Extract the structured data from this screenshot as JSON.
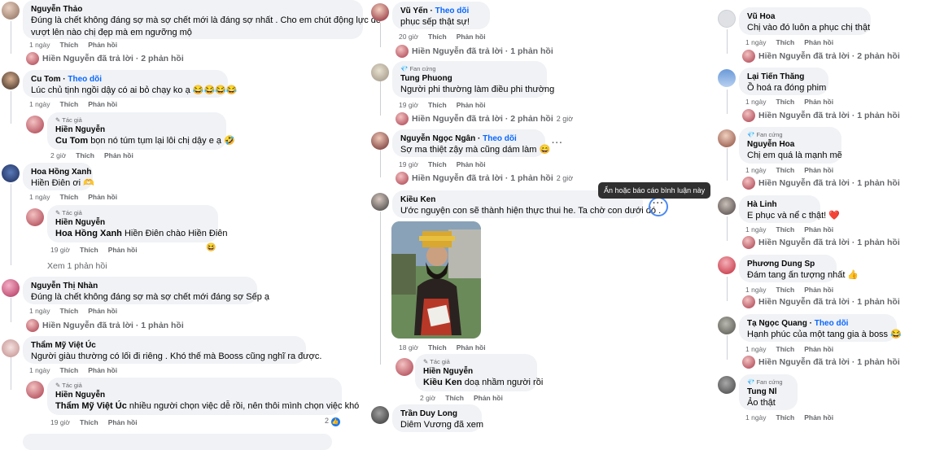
{
  "labels": {
    "like": "Thích",
    "reply": "Phản hồi",
    "author": "Tác giả",
    "fan": "Fan cứng",
    "follow": "Theo dõi"
  },
  "col1": [
    {
      "name": "Nguyễn Thảo",
      "text1": "Đúng là chết không đáng sợ mà sợ chết mới là đáng sợ nhất . Cho em chút động lực để",
      "text2": "vượt lên nào chị đẹp mà em ngưỡng mộ",
      "time": "1 ngày",
      "reply_line": "Hiền Nguyễn đã trả lời · 2 phản hồi"
    },
    {
      "name": "Cu Tom",
      "text": "Lúc chủ tịnh ngồi dậy có ai bỏ chạy ko ạ 😂😂😂😂",
      "time": "1 ngày"
    },
    {
      "name": "Hiền Nguyễn",
      "tag": "Cu Tom",
      "text": "bọn nó túm tụm lại lôi chị dậy e ạ 🤣",
      "time": "2 giờ"
    },
    {
      "name": "Hoa Hồng Xanh",
      "text": "Hiền Điên ơi 🫶",
      "time": "1 ngày"
    },
    {
      "name": "Hiền Nguyễn",
      "tag": "Hoa Hồng Xanh",
      "text": "Hiền Điên chào Hiền Điên",
      "time": "19 giờ",
      "emoji": "😆"
    },
    {
      "more": "Xem 1 phản hồi"
    },
    {
      "name": "Nguyễn Thị Nhàn",
      "text": "Đúng là chết không đáng sợ mà sợ chết mới đáng sợ Sếp ạ",
      "time": "1 ngày",
      "reply_line": "Hiền Nguyễn đã trả lời · 1 phản hồi"
    },
    {
      "name": "Thẩm Mỹ Việt Úc",
      "text": "Người giàu thường có lối đi riêng . Khó thế mà Booss cũng nghĩ ra được.",
      "time": "1 ngày"
    },
    {
      "name": "Hiền Nguyễn",
      "tag": "Thẩm Mỹ Việt Úc",
      "text": "nhiều người chọn việc dễ rồi, nên thôi mình chọn việc khó",
      "time": "19 giờ",
      "react_count": "2"
    }
  ],
  "col2": [
    {
      "name": "Vũ Yến",
      "text": "phục sếp thật sự!",
      "time": "20 giờ",
      "reply_line": "Hiền Nguyễn đã trả lời · 1 phản hồi"
    },
    {
      "name": "Tung Phuong",
      "text": "Người phi thường làm điều phi thường",
      "time": "19 giờ",
      "reply_line": "Hiền Nguyễn đã trả lời · 2 phản hồi",
      "reply_time": "2 giờ"
    },
    {
      "name": "Nguyễn Ngọc Ngân",
      "text": "Sợ ma thiệt zậy mà cũng dám làm 😄",
      "time": "19 giờ",
      "reply_line": "Hiền Nguyễn đã trả lời · 1 phản hồi",
      "reply_time": "2 giờ"
    },
    {
      "name": "Kiều Ken",
      "text": "Ước nguyện con sẽ thành hiện thực thui he. Ta chờ con dưới đó .",
      "time": "18 giờ",
      "tooltip": "Ẩn hoặc báo cáo bình luận này"
    },
    {
      "name": "Hiền Nguyễn",
      "tag": "Kiều Ken",
      "text": "doạ nhầm người rồi",
      "time": "2 giờ"
    },
    {
      "name": "Trần Duy Long",
      "text": "Diêm Vương đã xem"
    }
  ],
  "col3": [
    {
      "name": "Vũ Hoa",
      "text": "Chị vào đó luôn a phục chị thật",
      "time": "1 ngày",
      "reply_line": "Hiền Nguyễn đã trả lời · 2 phản hồi"
    },
    {
      "name": "Lại Tiến Thăng",
      "text": "Ồ hoá ra đóng phim",
      "time": "1 ngày",
      "reply_line": "Hiền Nguyễn đã trả lời · 1 phản hồi"
    },
    {
      "name": "Nguyễn Hoa",
      "text": "Chị em quá là mạnh mẽ",
      "time": "1 ngày",
      "reply_line": "Hiền Nguyễn đã trả lời · 1 phản hồi"
    },
    {
      "name": "Hà Linh",
      "text": "E phục và nể c thật! ❤️",
      "time": "1 ngày",
      "reply_line": "Hiền Nguyễn đã trả lời · 1 phản hồi"
    },
    {
      "name": "Phương Dung Sp",
      "text": "Đám tang ấn tượng nhất 👍",
      "time": "1 ngày",
      "reply_line": "Hiền Nguyễn đã trả lời · 1 phản hồi"
    },
    {
      "name": "Tạ Ngọc Quang",
      "text": "Hạnh phúc của một tang gia à boss 😂",
      "time": "1 ngày",
      "reply_line": "Hiền Nguyễn đã trả lời · 1 phản hồi"
    },
    {
      "name": "Tung Nl",
      "text": "Ảo thật",
      "time": "1 ngày"
    }
  ]
}
